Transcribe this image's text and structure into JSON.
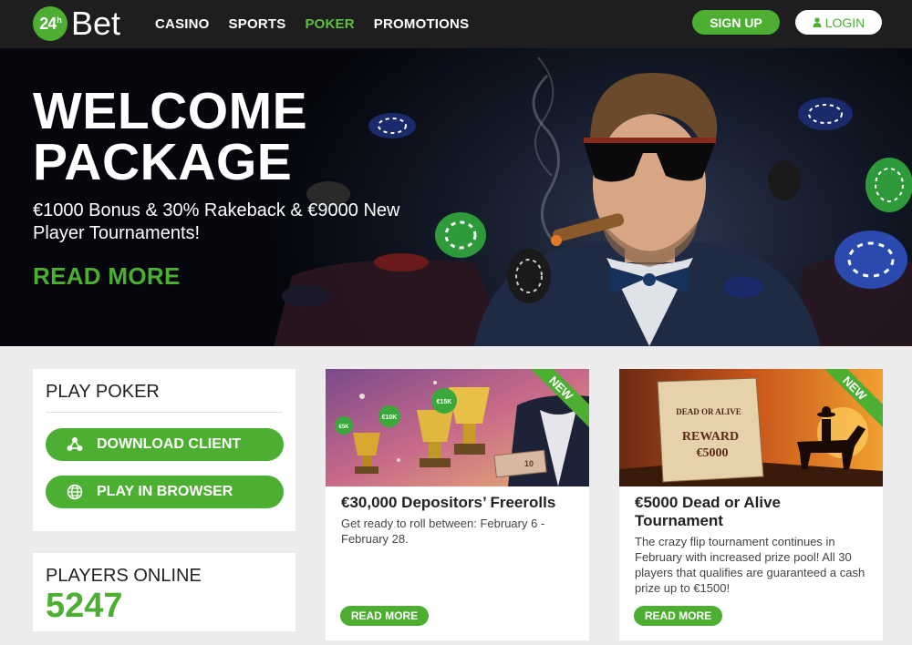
{
  "header": {
    "logo": {
      "badge": "24",
      "badge_sup": "h",
      "text": "Bet"
    },
    "nav": [
      "CASINO",
      "SPORTS",
      "POKER",
      "PROMOTIONS"
    ],
    "active_nav": "POKER",
    "signup_label": "SIGN UP",
    "login_label": "LOGIN"
  },
  "hero": {
    "title_line1": "WELCOME",
    "title_line2": "PACKAGE",
    "subtitle": "€1000 Bonus & 30% Rakeback & €9000 New Player Tournaments!",
    "cta": "READ MORE"
  },
  "play_poker": {
    "title": "PLAY POKER",
    "download_label": "DOWNLOAD CLIENT",
    "browser_label": "PLAY IN BROWSER"
  },
  "players_online": {
    "title": "PLAYERS ONLINE",
    "count": "5247"
  },
  "promos": [
    {
      "badge": "NEW",
      "title": "€30,000 Depositors’ Freerolls",
      "description": "Get ready to roll between: February 6 - February 28.",
      "cta": "READ MORE",
      "image_labels": [
        "€5K",
        "€10K",
        "€15K",
        "10"
      ]
    },
    {
      "badge": "NEW",
      "title": "€5000 Dead or Alive Tournament",
      "description": "The crazy flip tournament continues in February with increased prize pool! All 30 players that qualifies are guaranteed a cash prize up to €1500!",
      "cta": "READ MORE",
      "image_labels": [
        "DEAD OR ALIVE",
        "REWARD",
        "€5000"
      ]
    }
  ],
  "colors": {
    "accent": "#4caf32",
    "header_bg": "#1e1e1e",
    "page_bg": "#ececec"
  }
}
